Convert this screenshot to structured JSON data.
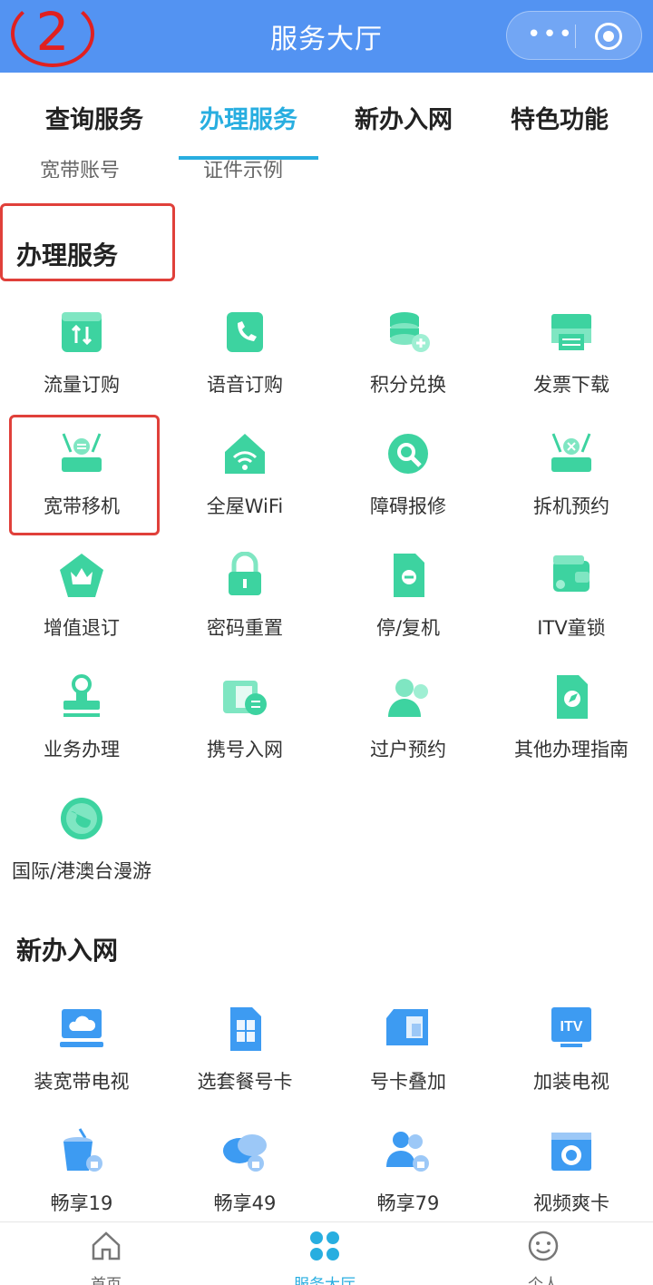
{
  "header": {
    "title": "服务大厅",
    "step_marker": "2"
  },
  "tabs": [
    {
      "label": "查询服务"
    },
    {
      "label": "办理服务"
    },
    {
      "label": "新办入网"
    },
    {
      "label": "特色功能"
    }
  ],
  "peek": [
    "宽带账号",
    "证件示例"
  ],
  "section_handle": {
    "title": "办理服务",
    "items": [
      {
        "label": "流量订购",
        "icon": "traffic-icon"
      },
      {
        "label": "语音订购",
        "icon": "phone-icon"
      },
      {
        "label": "积分兑换",
        "icon": "coins-icon"
      },
      {
        "label": "发票下载",
        "icon": "printer-icon"
      },
      {
        "label": "宽带移机",
        "icon": "router-move-icon"
      },
      {
        "label": "全屋WiFi",
        "icon": "home-wifi-icon"
      },
      {
        "label": "障碍报修",
        "icon": "repair-icon"
      },
      {
        "label": "拆机预约",
        "icon": "router-remove-icon"
      },
      {
        "label": "增值退订",
        "icon": "crown-icon"
      },
      {
        "label": "密码重置",
        "icon": "lock-icon"
      },
      {
        "label": "停/复机",
        "icon": "phone-stop-icon"
      },
      {
        "label": "ITV童锁",
        "icon": "wallet-icon"
      },
      {
        "label": "业务办理",
        "icon": "stamp-icon"
      },
      {
        "label": "携号入网",
        "icon": "sim-transfer-icon"
      },
      {
        "label": "过户预约",
        "icon": "user-transfer-icon"
      },
      {
        "label": "其他办理指南",
        "icon": "compass-icon"
      },
      {
        "label": "国际/港澳台漫游",
        "icon": "globe-icon"
      }
    ]
  },
  "section_new": {
    "title": "新办入网",
    "items": [
      {
        "label": "装宽带电视",
        "icon": "monitor-cloud-icon"
      },
      {
        "label": "选套餐号卡",
        "icon": "sim-card-icon"
      },
      {
        "label": "号卡叠加",
        "icon": "card-stack-icon"
      },
      {
        "label": "加装电视",
        "icon": "itv-icon"
      },
      {
        "label": "畅享19",
        "icon": "drink-icon"
      },
      {
        "label": "畅享49",
        "icon": "chat-icon"
      },
      {
        "label": "畅享79",
        "icon": "users-icon"
      },
      {
        "label": "视频爽卡",
        "icon": "video-card-icon"
      }
    ]
  },
  "bottom_nav": [
    {
      "label": "首页",
      "icon": "home-icon"
    },
    {
      "label": "服务大厅",
      "icon": "grid-icon"
    },
    {
      "label": "个人",
      "icon": "smile-icon"
    }
  ],
  "colors": {
    "header": "#5393f2",
    "accent": "#28aee0",
    "green_icon": "#3dd3a0",
    "blue_icon": "#3d9bf2",
    "highlight": "#e0403a"
  }
}
